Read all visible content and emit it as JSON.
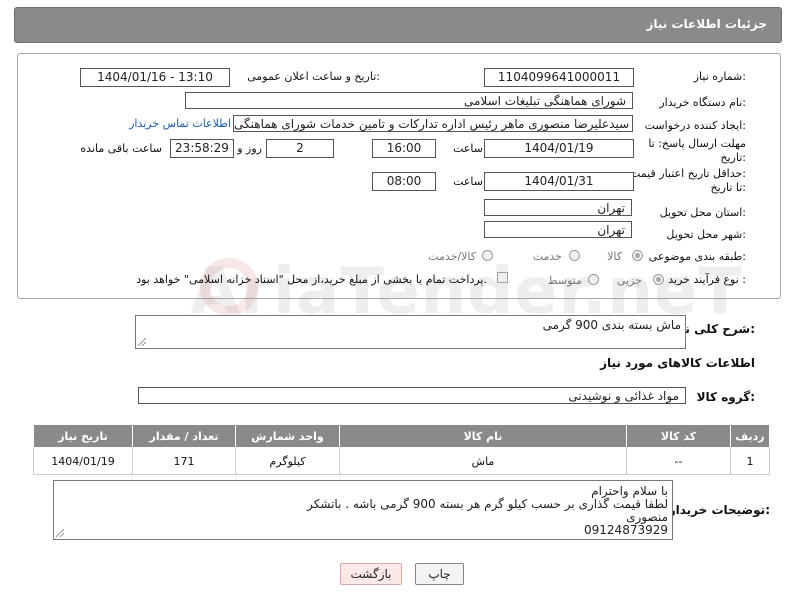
{
  "header": {
    "title": "جزئیات اطلاعات نیاز"
  },
  "fields": {
    "need_number_label": "شماره نیاز:",
    "need_number": "1104099641000011",
    "announce_label": "تاریخ و ساعت اعلان عمومی:",
    "announce_value": "1404/01/16 - 13:10",
    "buyer_org_label": "نام دستگاه خریدار:",
    "buyer_org": "شورای هماهنگی تبلیغات اسلامی",
    "creator_label": "ایجاد کننده درخواست:",
    "creator": "سیدعلیرضا منصوری ماهر رئیس اداره تداركات و تامین خدمات  شورای هماهنگی",
    "contact_link": "اطلاعات تماس خریدار",
    "deadline_label_1": "مهلت ارسال پاسخ: تا",
    "deadline_label_2": "تاریخ:",
    "deadline_date": "1404/01/19",
    "time_label": "ساعت",
    "deadline_time": "16:00",
    "days_count": "2",
    "days_label": "روز و",
    "remaining_time": "23:58:29",
    "remaining_label": "ساعت باقی مانده",
    "validity_label_1": "حداقل تاریخ اعتبار قیمت:",
    "validity_label_2": "تا تاریخ:",
    "validity_date": "1404/01/31",
    "validity_time": "08:00",
    "province_label": "استان محل تحویل:",
    "province": "تهران",
    "city_label": "شهر محل تحویل:",
    "city": "تهران",
    "category_label": "طبقه بندی موضوعی:",
    "category_options": [
      "کالا",
      "خدمت",
      "کالا/خدمت"
    ],
    "category_selected": "کالا",
    "process_label": "نوع فرآیند خرید :",
    "process_options": [
      "جزیی",
      "متوسط"
    ],
    "process_selected": "جزیی",
    "payment_note": "پرداخت تمام یا بخشی از مبلغ خرید،از محل \"اسناد خزانه اسلامی\" خواهد بود."
  },
  "description": {
    "label": "شرح کلی نیاز:",
    "value": "ماش بسته بندی 900 گرمی"
  },
  "goods_section": {
    "title": "اطلاعات کالاهای مورد نیاز",
    "group_label": "گروه کالا:",
    "group_value": "مواد غذائی و نوشیدنی"
  },
  "table": {
    "headers": [
      "ردیف",
      "کد کالا",
      "نام کالا",
      "واحد شمارش",
      "تعداد / مقدار",
      "تاریخ نیاز"
    ],
    "rows": [
      [
        "1",
        "--",
        "ماش",
        "کیلوگرم",
        "171",
        "1404/01/19"
      ]
    ]
  },
  "buyer_notes": {
    "label": "توضیحات خریدار:",
    "lines": [
      "با سلام واحترام",
      "لطفا قیمت گذاری بر حسب کیلو گرم هر بسته 900 گرمی باشه . باتشکر",
      "منصوری",
      "09124873929"
    ]
  },
  "buttons": {
    "print": "چاپ",
    "back": "بازگشت"
  },
  "watermark": "AriaTender.neT",
  "colors": {
    "header_bg": "#8a8a8a",
    "link": "#1a5ca8",
    "back_button_bg": "#fde8e8"
  }
}
